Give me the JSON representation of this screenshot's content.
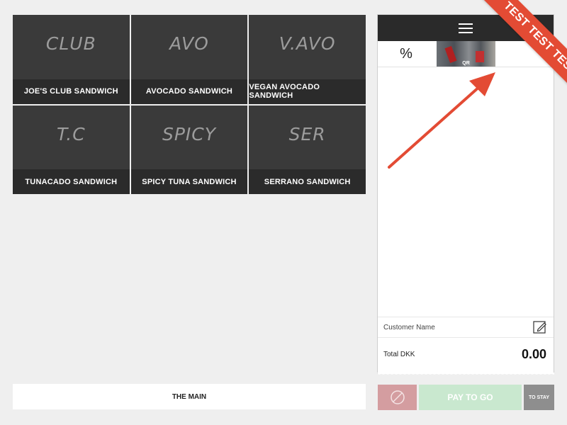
{
  "products": [
    {
      "code": "CLUB",
      "name": "JOE'S CLUB SANDWICH"
    },
    {
      "code": "AVO",
      "name": "AVOCADO SANDWICH"
    },
    {
      "code": "V.AVO",
      "name": "VEGAN AVOCADO SANDWICH"
    },
    {
      "code": "T.C",
      "name": "TUNACADO SANDWICH"
    },
    {
      "code": "SPICY",
      "name": "SPICY TUNA SANDWICH"
    },
    {
      "code": "SER",
      "name": "SERRANO SANDWICH"
    }
  ],
  "category": {
    "label": "THE MAIN"
  },
  "order": {
    "discount_symbol": "%",
    "qr_label": "QR",
    "customer_name_label": "Customer Name",
    "total_label": "Total DKK",
    "total_value": "0.00"
  },
  "actions": {
    "pay_label": "PAY TO GO",
    "stay_label": "TO STAY"
  },
  "ribbon": {
    "text": "TEST TEST TEST"
  },
  "colors": {
    "tile": "#3a3a3a",
    "tile_label": "#2b2b2b",
    "cancel": "#d49da0",
    "pay": "#c9e8cf",
    "stay": "#8e8e8e",
    "ribbon": "#e34b34",
    "arrow": "#e34b34"
  },
  "icons": {
    "menu": "hamburger-icon",
    "edit": "edit-icon",
    "cancel": "cancel-icon"
  }
}
